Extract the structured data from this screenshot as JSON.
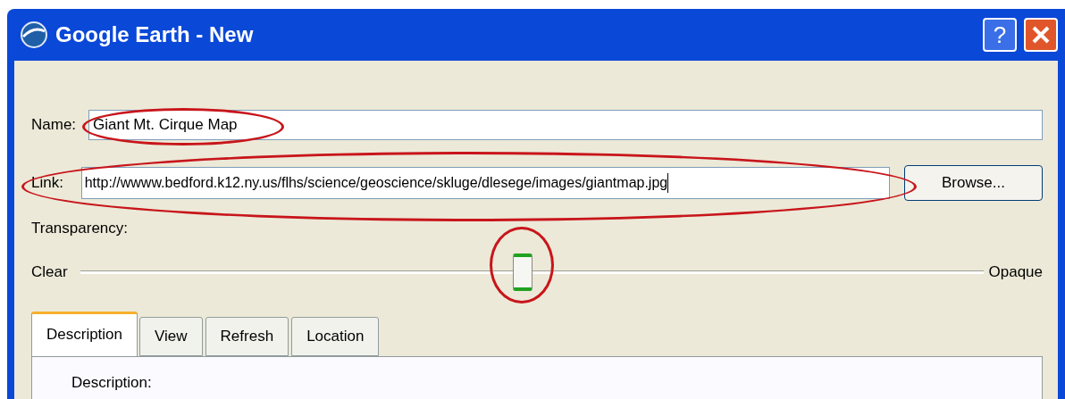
{
  "window": {
    "title": "Google Earth - New",
    "help_button": "?"
  },
  "name": {
    "label": "Name:",
    "value": "Giant Mt. Cirque Map"
  },
  "link": {
    "label": "Link:",
    "value": "http://wwww.bedford.k12.ny.us/flhs/science/geoscience/skluge/dlesege/images/giantmap.jpg",
    "button": "Browse..."
  },
  "transparency": {
    "label": "Transparency:",
    "min_label": "Clear",
    "max_label": "Opaque",
    "level": 0.49
  },
  "tabs": [
    {
      "label": "Description",
      "selected": true
    },
    {
      "label": "View",
      "selected": false
    },
    {
      "label": "Refresh",
      "selected": false
    },
    {
      "label": "Location",
      "selected": false
    }
  ],
  "panel": {
    "label": "Description:"
  }
}
